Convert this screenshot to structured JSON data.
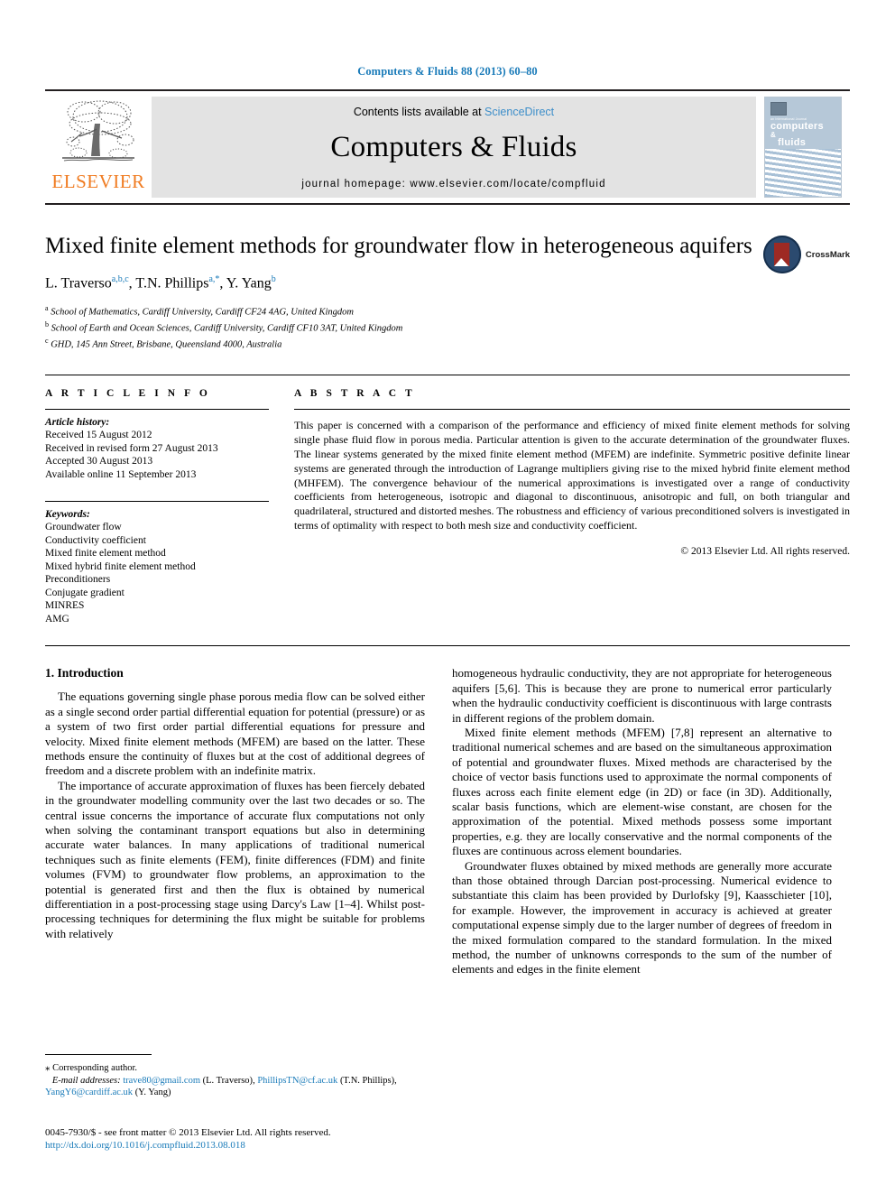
{
  "running_head": "Computers & Fluids 88 (2013) 60–80",
  "masthead": {
    "publisher_name": "ELSEVIER",
    "contents_prefix": "Contents lists available at ",
    "sciencedirect": "ScienceDirect",
    "journal_name": "Computers & Fluids",
    "homepage": "journal homepage: www.elsevier.com/locate/compfluid",
    "cover": {
      "small_line": "an International Journal",
      "line1": "computers",
      "amp": "&",
      "line2": "fluids"
    }
  },
  "article": {
    "title": "Mixed finite element methods for groundwater flow in heterogeneous aquifers",
    "crossmark_label": "CrossMark",
    "authors": [
      {
        "name": "L. Traverso",
        "sup": "a,b,c"
      },
      {
        "name": "T.N. Phillips",
        "sup": "a,*"
      },
      {
        "name": "Y. Yang",
        "sup": "b"
      }
    ],
    "affiliations": [
      {
        "mark": "a",
        "text": "School of Mathematics, Cardiff University, Cardiff CF24 4AG, United Kingdom"
      },
      {
        "mark": "b",
        "text": "School of Earth and Ocean Sciences, Cardiff University, Cardiff CF10 3AT, United Kingdom"
      },
      {
        "mark": "c",
        "text": "GHD, 145 Ann Street, Brisbane, Queensland 4000, Australia"
      }
    ]
  },
  "article_info": {
    "heading": "A R T I C L E    I N F O",
    "history_label": "Article history:",
    "history": [
      "Received 15 August 2012",
      "Received in revised form 27 August 2013",
      "Accepted 30 August 2013",
      "Available online 11 September 2013"
    ],
    "keywords_label": "Keywords:",
    "keywords": [
      "Groundwater flow",
      "Conductivity coefficient",
      "Mixed finite element method",
      "Mixed hybrid finite element method",
      "Preconditioners",
      "Conjugate gradient",
      "MINRES",
      "AMG"
    ]
  },
  "abstract": {
    "heading": "A B S T R A C T",
    "text": "This paper is concerned with a comparison of the performance and efficiency of mixed finite element methods for solving single phase fluid flow in porous media. Particular attention is given to the accurate determination of the groundwater fluxes. The linear systems generated by the mixed finite element method (MFEM) are indefinite. Symmetric positive definite linear systems are generated through the introduction of Lagrange multipliers giving rise to the mixed hybrid finite element method (MHFEM). The convergence behaviour of the numerical approximations is investigated over a range of conductivity coefficients from heterogeneous, isotropic and diagonal to discontinuous, anisotropic and full, on both triangular and quadrilateral, structured and distorted meshes. The robustness and efficiency of various preconditioned solvers is investigated in terms of optimality with respect to both mesh size and conductivity coefficient.",
    "copyright": "© 2013 Elsevier Ltd. All rights reserved."
  },
  "body": {
    "section_title": "1. Introduction",
    "left_paragraphs": [
      "The equations governing single phase porous media flow can be solved either as a single second order partial differential equation for potential (pressure) or as a system of two first order partial differential equations for pressure and velocity. Mixed finite element methods (MFEM) are based on the latter. These methods ensure the continuity of fluxes but at the cost of additional degrees of freedom and a discrete problem with an indefinite matrix.",
      "The importance of accurate approximation of fluxes has been fiercely debated in the groundwater modelling community over the last two decades or so. The central issue concerns the importance of accurate flux computations not only when solving the contaminant transport equations but also in determining accurate water balances. In many applications of traditional numerical techniques such as finite elements (FEM), finite differences (FDM) and finite volumes (FVM) to groundwater flow problems, an approximation to the potential is generated first and then the flux is obtained by numerical differentiation in a post-processing stage using Darcy's Law [1–4]. Whilst post-processing techniques for determining the flux might be suitable for problems with relatively"
    ],
    "right_paragraphs": [
      "homogeneous hydraulic conductivity, they are not appropriate for heterogeneous aquifers [5,6]. This is because they are prone to numerical error particularly when the hydraulic conductivity coefficient is discontinuous with large contrasts in different regions of the problem domain.",
      "Mixed finite element methods (MFEM) [7,8] represent an alternative to traditional numerical schemes and are based on the simultaneous approximation of potential and groundwater fluxes. Mixed methods are characterised by the choice of vector basis functions used to approximate the normal components of fluxes across each finite element edge (in 2D) or face (in 3D). Additionally, scalar basis functions, which are element-wise constant, are chosen for the approximation of the potential. Mixed methods possess some important properties, e.g. they are locally conservative and the normal components of the fluxes are continuous across element boundaries.",
      "Groundwater fluxes obtained by mixed methods are generally more accurate than those obtained through Darcian post-processing. Numerical evidence to substantiate this claim has been provided by Durlofsky [9], Kaasschieter [10], for example. However, the improvement in accuracy is achieved at greater computational expense simply due to the larger number of degrees of freedom in the mixed formulation compared to the standard formulation. In the mixed method, the number of unknowns corresponds to the sum of the number of elements and edges in the finite element"
    ]
  },
  "footnote": {
    "corresponding": "Corresponding author.",
    "email_label": "E-mail addresses:",
    "emails": [
      {
        "address": "trave80@gmail.com",
        "owner": "(L. Traverso)"
      },
      {
        "address": "PhillipsTN@cf.ac.uk",
        "owner": "(T.N. Phillips)"
      },
      {
        "address": "YangY6@cardiff.ac.uk",
        "owner": "(Y. Yang)"
      }
    ]
  },
  "footer": {
    "issn_line": "0045-7930/$ - see front matter © 2013 Elsevier Ltd. All rights reserved.",
    "doi": "http://dx.doi.org/10.1016/j.compfluid.2013.08.018"
  },
  "colors": {
    "link_blue": "#1a7bb9",
    "elsevier_orange": "#f07c22",
    "banner_gray": "#e3e3e3",
    "crossmark_blue": "#2b4a6f",
    "crossmark_red": "#9e2a24"
  }
}
